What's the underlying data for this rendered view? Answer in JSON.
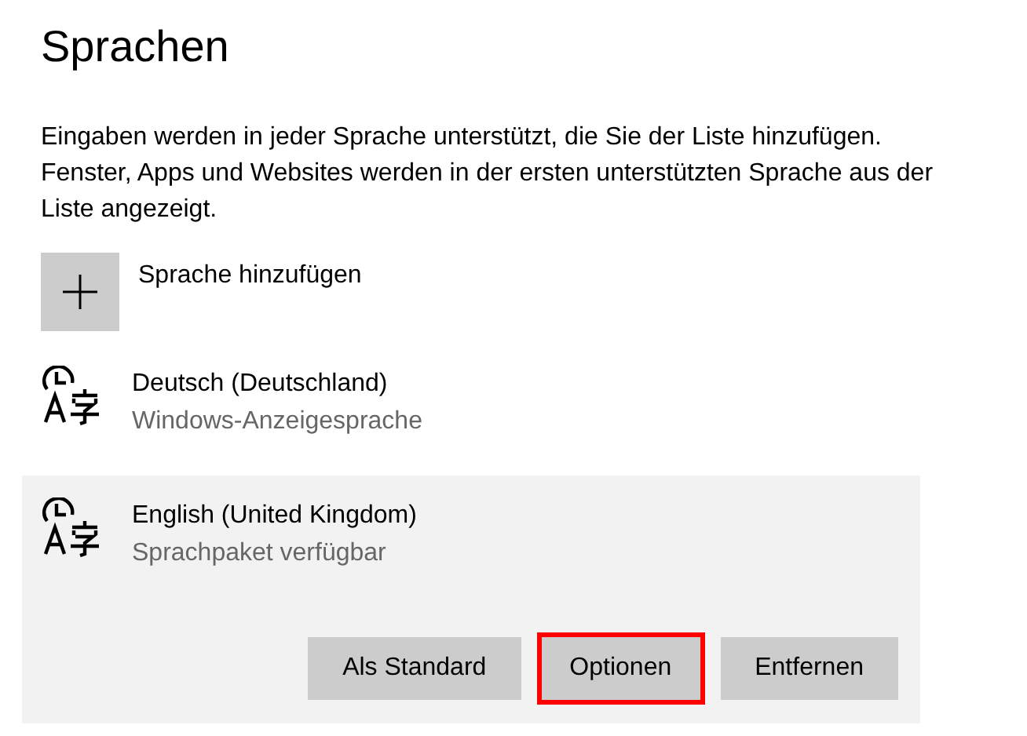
{
  "title": "Sprachen",
  "description": "Eingaben werden in jeder Sprache unterstützt, die Sie der Liste hinzufügen. Fenster, Apps und Websites werden in der ersten unterstützten Sprache aus der Liste angezeigt.",
  "add_button": {
    "label": "Sprache hinzufügen"
  },
  "languages": [
    {
      "name": "Deutsch (Deutschland)",
      "status": "Windows-Anzeigesprache",
      "selected": false
    },
    {
      "name": "English (United Kingdom)",
      "status": "Sprachpaket verfügbar",
      "selected": true
    }
  ],
  "buttons": [
    {
      "label": "Als Standard",
      "highlighted": false
    },
    {
      "label": "Optionen",
      "highlighted": true
    },
    {
      "label": "Entfernen",
      "highlighted": false
    }
  ]
}
